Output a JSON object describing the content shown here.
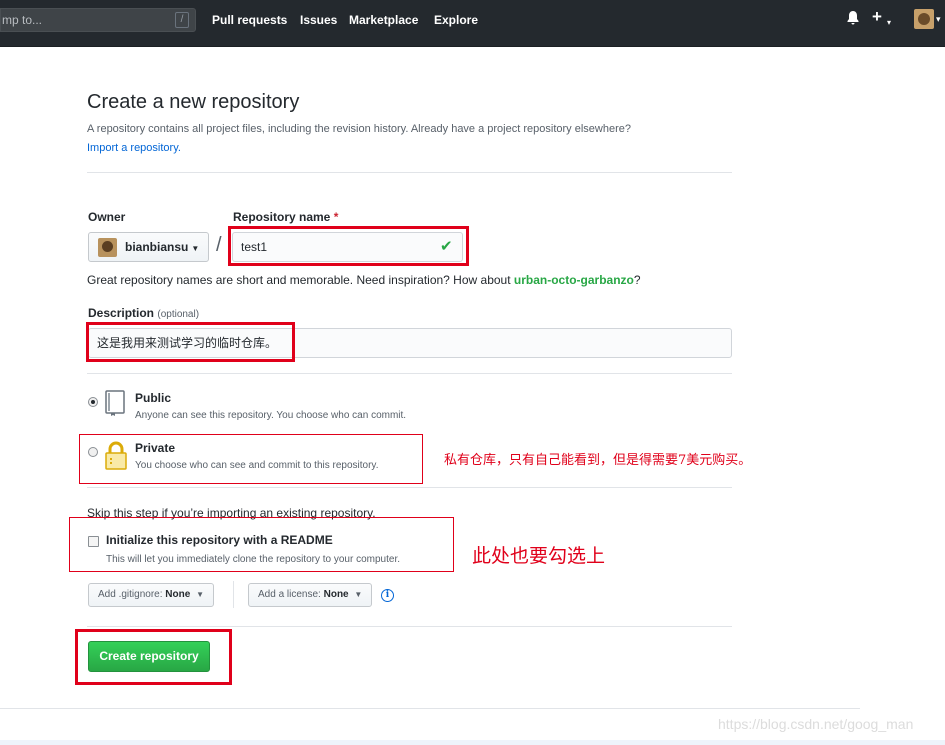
{
  "header": {
    "search_placeholder": "mp to...",
    "slash_key": "/",
    "nav": [
      "Pull requests",
      "Issues",
      "Marketplace",
      "Explore"
    ],
    "bell_icon": "bell-icon",
    "plus_icon": "plus-icon"
  },
  "page": {
    "title": "Create a new repository",
    "subtitle": "A repository contains all project files, including the revision history. Already have a project repository elsewhere?",
    "import_link": "Import a repository."
  },
  "form": {
    "owner_label": "Owner",
    "owner_value": "bianbiansu",
    "repo_label": "Repository name",
    "required_mark": "*",
    "repo_value": "test1",
    "name_hint_prefix": "Great repository names are short and memorable. Need inspiration? How about ",
    "name_suggestion": "urban-octo-garbanzo",
    "name_hint_suffix": "?",
    "description_label": "Description",
    "description_optional": "(optional)",
    "description_value": "这是我用来测试学习的临时仓库。",
    "visibility": {
      "public_title": "Public",
      "public_desc": "Anyone can see this repository. You choose who can commit.",
      "private_title": "Private",
      "private_desc": "You choose who can see and commit to this repository.",
      "selected": "public"
    },
    "skip_text": "Skip this step if you’re importing an existing repository.",
    "init_title": "Initialize this repository with a README",
    "init_desc": "This will let you immediately clone the repository to your computer.",
    "init_checked": false,
    "gitignore_label": "Add .gitignore:",
    "gitignore_value": "None",
    "license_label": "Add a license:",
    "license_value": "None",
    "info_glyph": "i",
    "submit_label": "Create repository"
  },
  "annotations": {
    "private_note": "私有仓库，只有自己能看到，但是得需要7美元购买。",
    "readme_note": "此处也要勾选上",
    "color": "#e0001a"
  },
  "watermark": "https://blog.csdn.net/goog_man",
  "colors": {
    "header_bg": "#24292e",
    "link": "#0366d6",
    "success": "#28a745"
  }
}
